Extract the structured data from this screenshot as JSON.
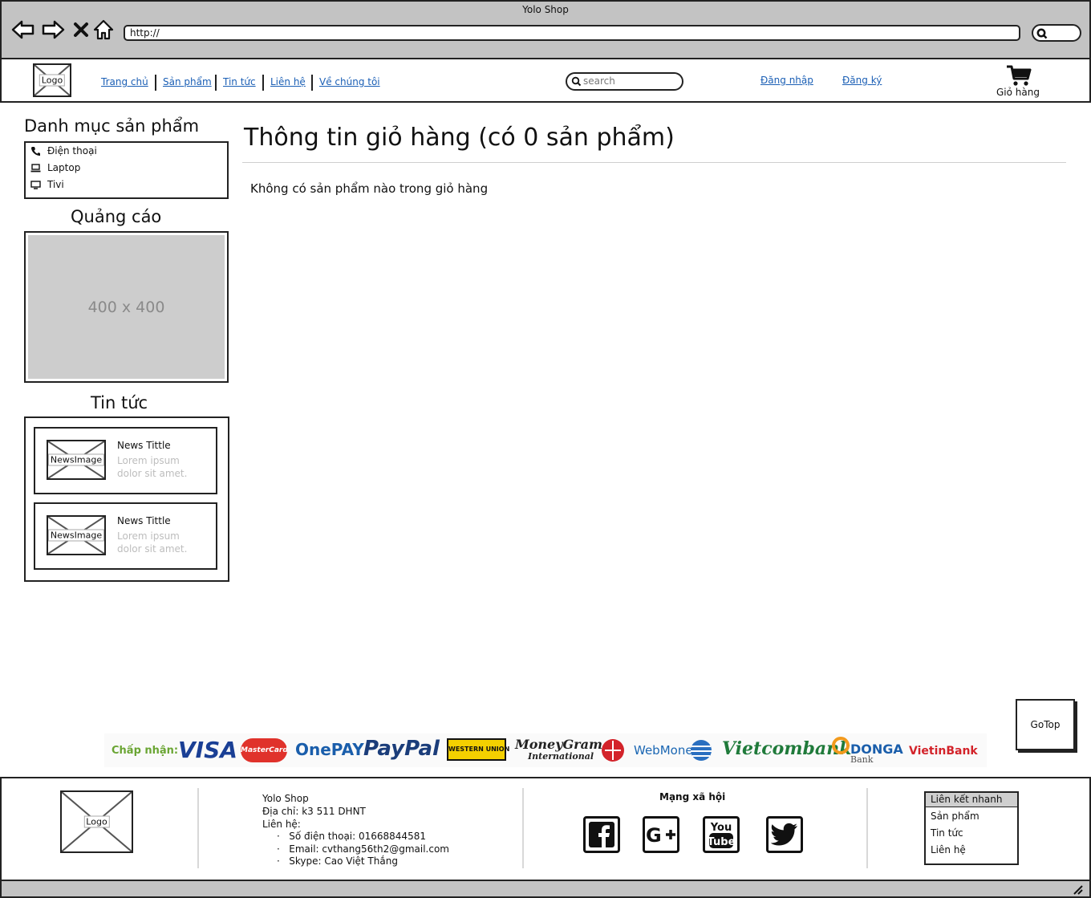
{
  "window": {
    "title": "Yolo Shop",
    "url": "http://"
  },
  "header": {
    "logo": "Logo",
    "nav": [
      "Trang chủ",
      "Sản phẩm",
      "Tin tức",
      "Liên hệ",
      "Về chúng tôi"
    ],
    "search_placeholder": "search",
    "login": "Đăng nhập",
    "register": "Đăng ký",
    "cart": "Giỏ hàng"
  },
  "sidebar": {
    "categories_title": "Danh mục sản phẩm",
    "categories": [
      {
        "label": "Điện thoại",
        "icon": "phone-icon"
      },
      {
        "label": "Laptop",
        "icon": "laptop-icon"
      },
      {
        "label": "Tivi",
        "icon": "tv-icon"
      }
    ],
    "ads_title": "Quảng cáo",
    "ad_placeholder": "400 x 400",
    "news_title": "Tin tức",
    "news": [
      {
        "image": "NewsImage",
        "title": "News Tittle",
        "text_1": "Lorem ipsum",
        "text_2": "dolor sit amet."
      },
      {
        "image": "NewsImage",
        "title": "News Tittle",
        "text_1": "Lorem ipsum",
        "text_2": "dolor sit amet."
      }
    ]
  },
  "main": {
    "title": "Thông tin giỏ hàng (có 0 sản phẩm)",
    "empty_message": "Không có sản phẩm nào trong giỏ hàng"
  },
  "gotop": "GoTop",
  "payment": {
    "accept_label": "Chấp nhận:",
    "brands": [
      "VISA",
      "MasterCard",
      "OnePAY",
      "PayPal",
      "WESTERN UNION",
      "MoneyGram",
      "International",
      "WebMoney",
      "Vietcombank",
      "DONGA",
      "Bank",
      "VietinBank"
    ]
  },
  "footer": {
    "logo": "Logo",
    "shop_name": "Yolo Shop",
    "address": "Địa chỉ: k3 511 DHNT",
    "contact_label": "Liên hệ:",
    "contacts": [
      "Số điện thoại: 01668844581",
      "Email: cvthang56th2@gmail.com",
      "Skype: Cao Việt Thắng"
    ],
    "social_title": "Mạng xã hội",
    "social": [
      "facebook",
      "google-plus",
      "youtube",
      "twitter"
    ],
    "quick_links_title": "Liên kết nhanh",
    "quick_links": [
      "Sản phẩm",
      "Tin tức",
      "Liên hệ"
    ]
  },
  "colors": {
    "link": "#1b5fb5",
    "chrome": "#c3c3c3",
    "accept_green": "#6aa533",
    "vietcombank_green": "#1f7a3a"
  }
}
